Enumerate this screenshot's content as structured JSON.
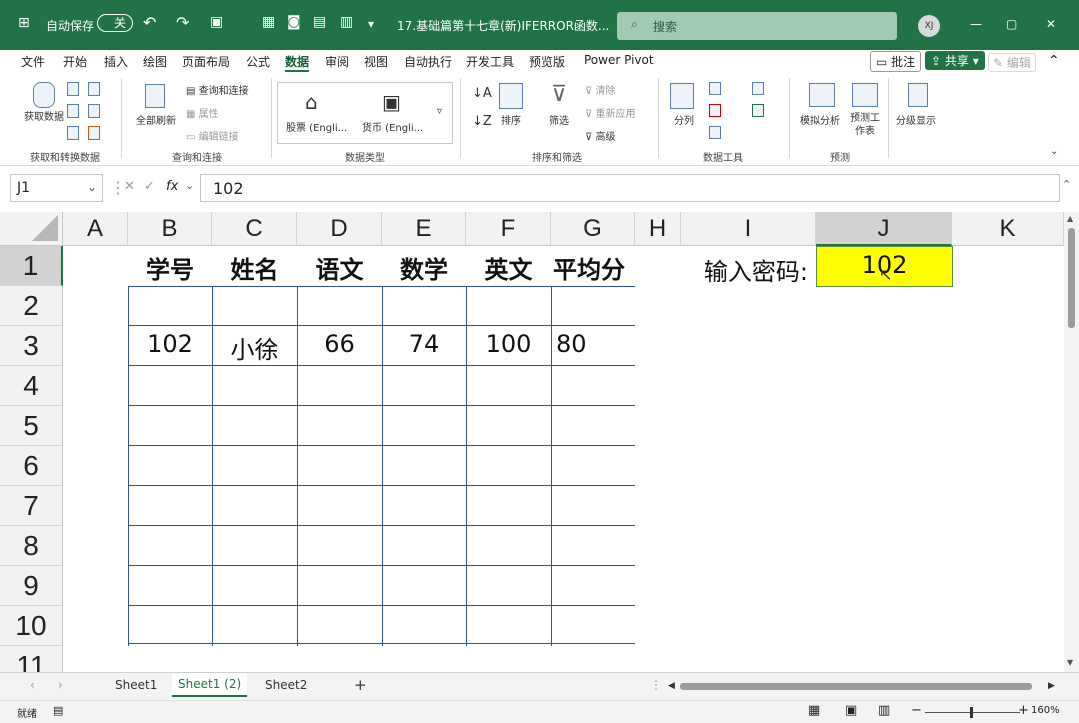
{
  "title": {
    "autosave_label": "自动保存",
    "autosave_state": "关",
    "filename": "17.基础篇第十七章(新)IFERROR函数...",
    "search_placeholder": "搜索",
    "user_initials": "XJ"
  },
  "menu": {
    "items": [
      "文件",
      "开始",
      "插入",
      "绘图",
      "页面布局",
      "公式",
      "数据",
      "审阅",
      "视图",
      "自动执行",
      "开发工具",
      "预览版",
      "Power Pivot"
    ],
    "active": "数据",
    "comments_label": "批注",
    "share_label": "共享",
    "editing_label": "编辑"
  },
  "ribbon": {
    "get_data": "获取数据",
    "group_get_transform": "获取和转换数据",
    "refresh_all": "全部刷新",
    "queries_connections": "查询和连接",
    "properties": "属性",
    "edit_links": "编辑链接",
    "group_queries": "查询和连接",
    "stocks": "股票 (Engli...",
    "currencies": "货币 (Engli...",
    "group_data_types": "数据类型",
    "sort": "排序",
    "filter": "筛选",
    "clear": "清除",
    "reapply": "重新应用",
    "advanced": "高级",
    "group_sort_filter": "排序和筛选",
    "text_to_columns": "分列",
    "group_data_tools": "数据工具",
    "what_if": "模拟分析",
    "forecast_sheet": "预测工作表",
    "group_forecast": "预测",
    "outline": "分级显示"
  },
  "formula_bar": {
    "name_box": "J1",
    "fx": "fx",
    "value": "102"
  },
  "grid": {
    "columns": [
      "A",
      "B",
      "C",
      "D",
      "E",
      "F",
      "G",
      "H",
      "I",
      "J",
      "K"
    ],
    "selected_column": "J",
    "rows": [
      "1",
      "2",
      "3",
      "4",
      "5",
      "6",
      "7",
      "8",
      "9",
      "10",
      "11"
    ],
    "headers": [
      "学号",
      "姓名",
      "语文",
      "数学",
      "英文",
      "平均分"
    ],
    "data_row": [
      "102",
      "小徐",
      "66",
      "74",
      "100",
      "80"
    ],
    "password_label": "输入密码:",
    "password_value": "102",
    "highlight_color": "#ffff00"
  },
  "sheets": {
    "tabs": [
      "Sheet1",
      "Sheet1 (2)",
      "Sheet2"
    ],
    "active": "Sheet1 (2)",
    "add_label": "+"
  },
  "status": {
    "ready": "就绪",
    "zoom": "160%"
  }
}
